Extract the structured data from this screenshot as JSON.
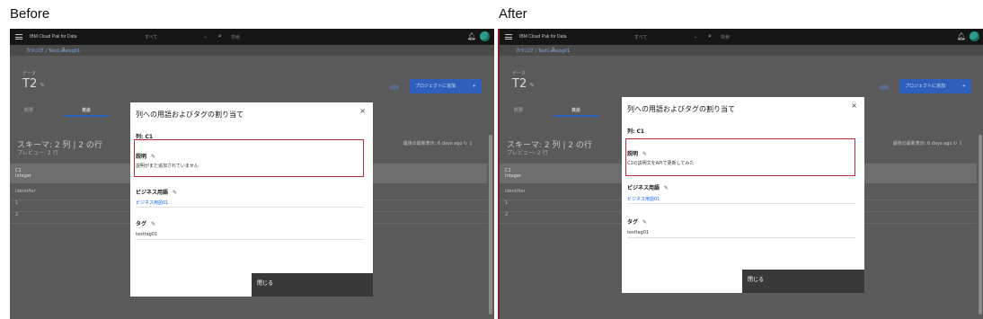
{
  "captions": {
    "before": "Before",
    "after": "After"
  },
  "app": {
    "brand": "IBM Cloud Pak for Data",
    "scope": "すべて",
    "search_placeholder": "検索",
    "breadcrumb": "カタログ / TestCatalog01",
    "asset_kind": "データ",
    "asset_title": "T2",
    "delete_label": "削除",
    "add_to_project": "プロジェクトに追加",
    "tabs": [
      "概要",
      "資産"
    ],
    "schema": "スキーマ: 2 列 | 2 の行",
    "preview": "プレビュー: 2 行",
    "last_viewed": "最後の最新表示: 6 days ago",
    "column_name": "C1",
    "column_type": "Integer",
    "rows": [
      "Identifier",
      "1",
      "2"
    ]
  },
  "modal": {
    "title": "列への用語およびタグの割り当て",
    "column_label": "列: C1",
    "description_label": "説明",
    "business_term_label": "ビジネス用語",
    "tag_label": "タグ",
    "close_button": "閉じる"
  },
  "before": {
    "description": "説明がまだ追加されていません",
    "business_term": "ビジネス用語01",
    "tag": "testtag01"
  },
  "after": {
    "description": "C1の説明文をAPIで更新してみた",
    "business_term": "ビジネス用語01",
    "tag": "testtag01"
  },
  "colors": {
    "highlight_border": "#c0293a",
    "primary_blue": "#0f62fe",
    "header_bg": "#161616"
  }
}
